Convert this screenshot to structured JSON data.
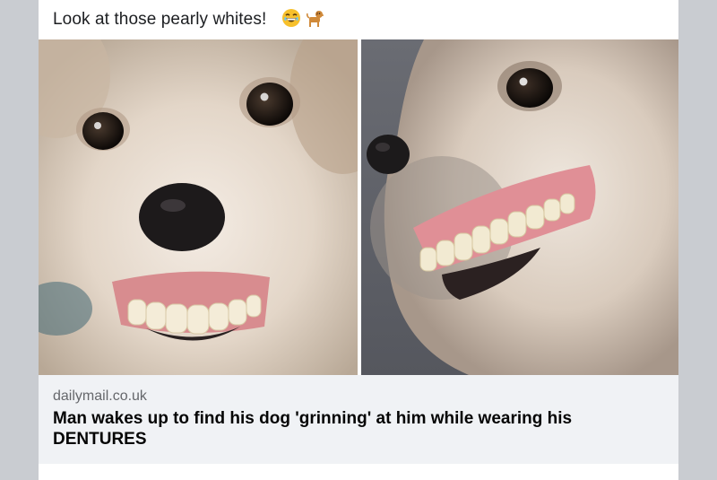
{
  "post": {
    "text": "Look at those pearly whites!",
    "emojis": [
      "grinning-face-emoji",
      "dog-emoji"
    ]
  },
  "photos": [
    {
      "name": "dog-grinning-front-photo"
    },
    {
      "name": "dog-grinning-side-photo"
    }
  ],
  "link_preview": {
    "domain": "dailymail.co.uk",
    "title": "Man wakes up to find his dog 'grinning' at him while wearing his DENTURES"
  },
  "colors": {
    "page_background": "#c9ccd1",
    "card_background": "#ffffff",
    "link_background": "#f0f2f5",
    "domain_text": "#65676b",
    "title_text": "#050505"
  }
}
